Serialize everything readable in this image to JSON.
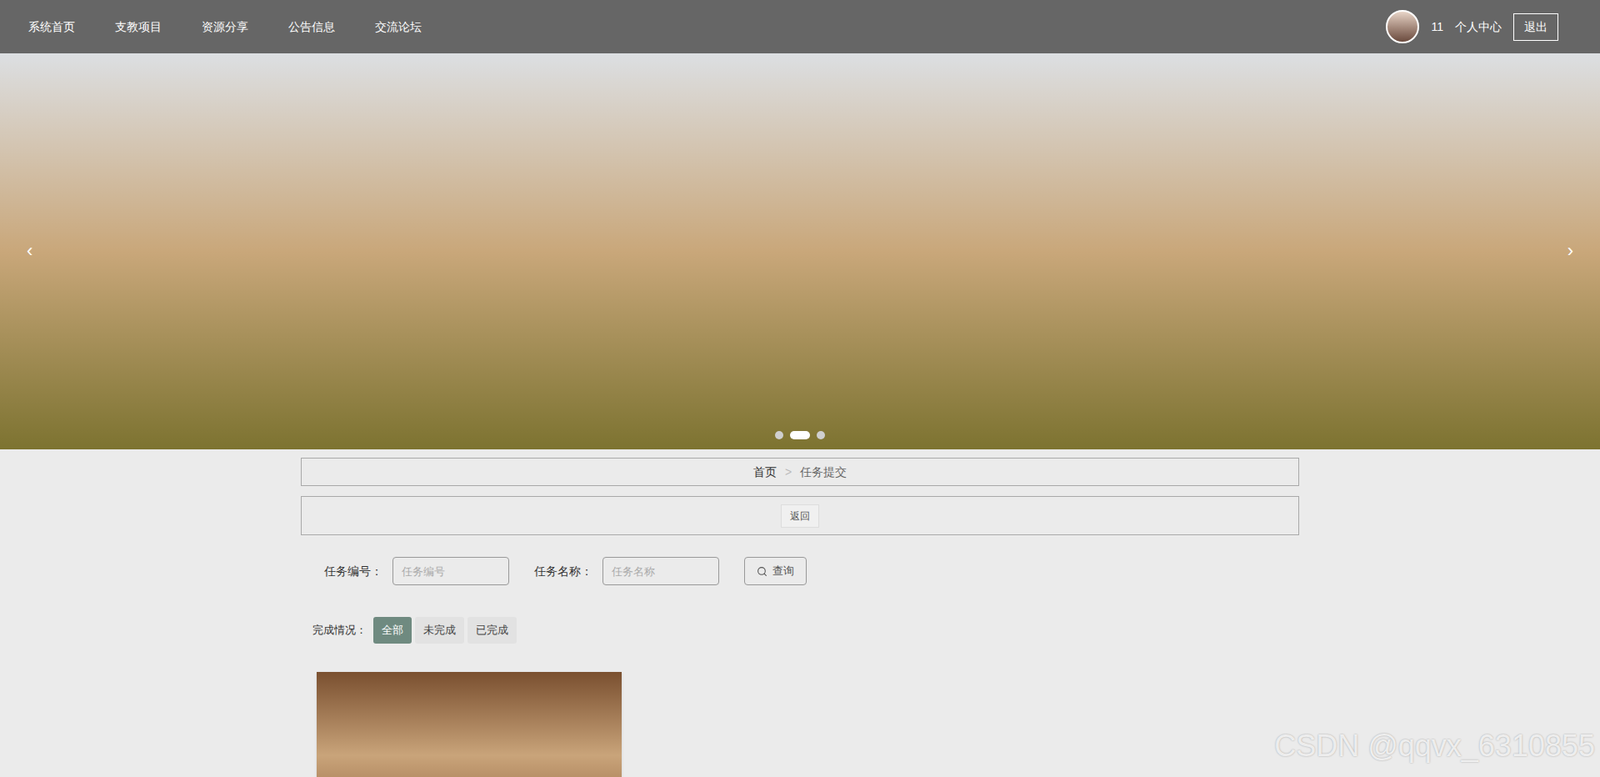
{
  "nav": {
    "items": [
      "系统首页",
      "支教项目",
      "资源分享",
      "公告信息",
      "交流论坛"
    ],
    "user": "11",
    "links": [
      "个人中心"
    ],
    "logout": "退出"
  },
  "banner": {
    "prev": "‹",
    "next": "›",
    "dots": [
      {
        "selected": false
      },
      {
        "selected": true
      },
      {
        "selected": false
      }
    ]
  },
  "breadcrumb": {
    "home": "首页",
    "separator": ">",
    "current": "任务提交"
  },
  "back_button": "返回",
  "search": {
    "fields": [
      {
        "label": "任务编号：",
        "placeholder": "任务编号"
      },
      {
        "label": "任务名称：",
        "placeholder": "任务名称"
      }
    ],
    "button": "查询"
  },
  "filter": {
    "label": "完成情况：",
    "options": [
      {
        "label": "全部",
        "selected": true
      },
      {
        "label": "未完成",
        "selected": false
      },
      {
        "label": "已完成",
        "selected": false
      }
    ]
  },
  "watermark": "CSDN @qqvx_6310855"
}
